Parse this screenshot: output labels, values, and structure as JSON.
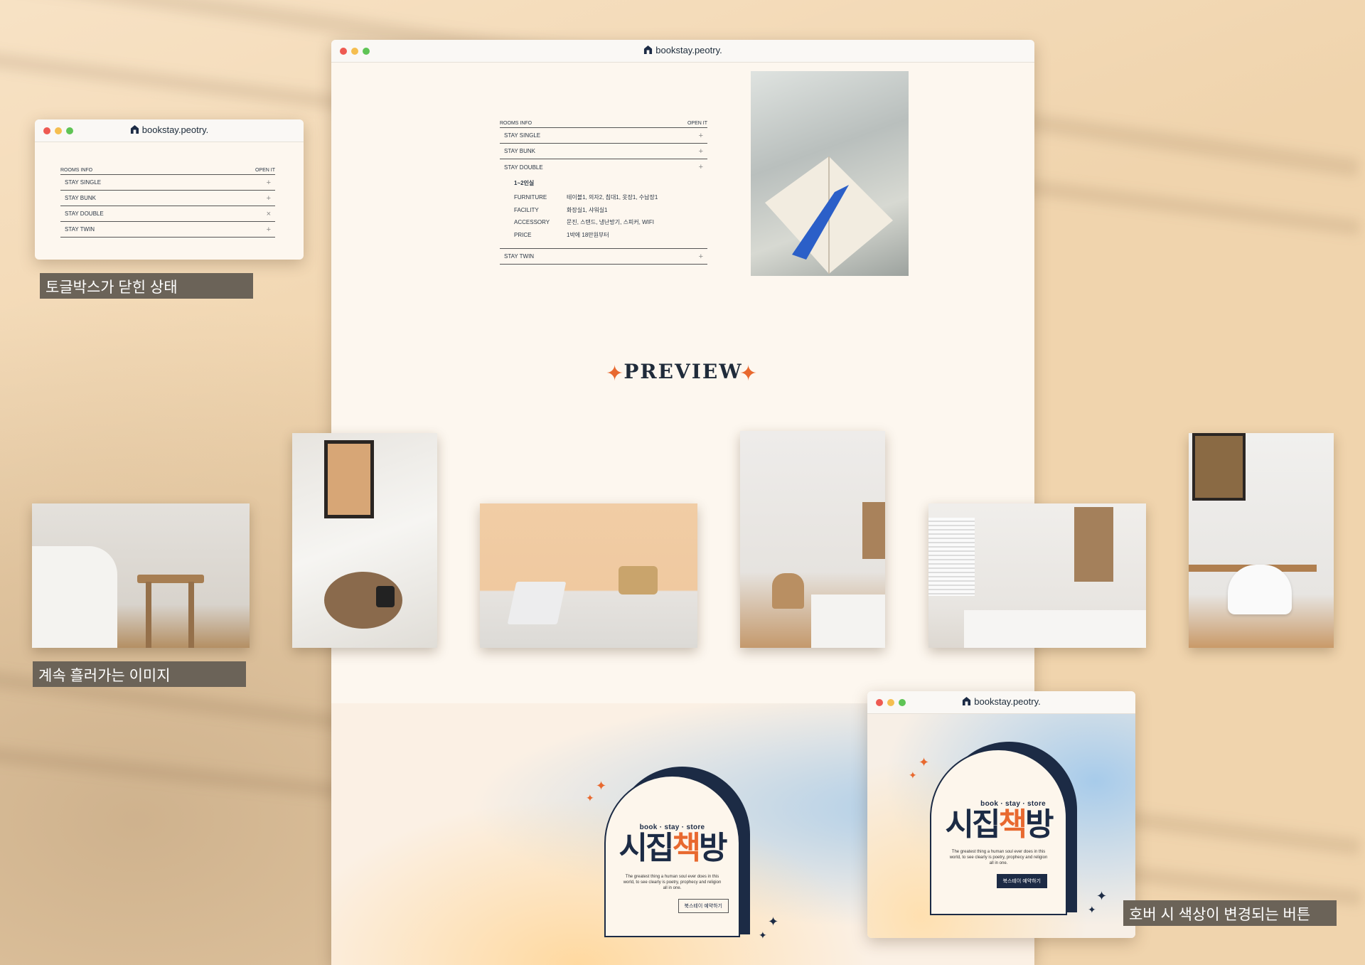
{
  "brand": "bookstay.peotry.",
  "small_window": {
    "title": "bookstay.peotry.",
    "header_left": "ROOMS INFO",
    "header_right": "OPEN IT",
    "rows": [
      {
        "label": "STAY SINGLE",
        "sign": "+"
      },
      {
        "label": "STAY BUNK",
        "sign": "+"
      },
      {
        "label": "STAY DOUBLE",
        "sign": "×"
      },
      {
        "label": "STAY TWIN",
        "sign": "+"
      }
    ]
  },
  "main_window": {
    "title": "bookstay.peotry.",
    "header_left": "ROOMS INFO",
    "header_right": "OPEN IT",
    "rows_top": [
      {
        "label": "STAY SINGLE",
        "sign": "+"
      },
      {
        "label": "STAY BUNK",
        "sign": "+"
      },
      {
        "label": "STAY DOUBLE",
        "sign": "+"
      }
    ],
    "detail": {
      "capacity": "1~2인실",
      "lines": [
        {
          "key": "FURNITURE",
          "value": "테이블1, 의자2, 침대1, 옷장1, 수납장1"
        },
        {
          "key": "FACILITY",
          "value": "화장실1, 샤워실1"
        },
        {
          "key": "ACCESSORY",
          "value": "문진, 스탠드, 냉난방기, 스피커, WIFI"
        },
        {
          "key": "PRICE",
          "value": "1박에 18만원부터"
        }
      ]
    },
    "row_bottom": {
      "label": "STAY TWIN",
      "sign": "+"
    },
    "preview_title": "PREVIEW"
  },
  "labels": {
    "toggle_closed": "토글박스가 닫힌 상태",
    "flowing_images": "계속 흘러가는 이미지",
    "hover_button": "호버 시 색상이 변경되는 버튼"
  },
  "card": {
    "small_title": "book · stay · store",
    "big_title_1": "시집",
    "big_title_2": "책",
    "big_title_3": "방",
    "tagline": "The greatest thing a human soul ever does in this world, to see clearly is poetry, prophecy and religion all in one.",
    "button": "북스테이 예약하기"
  },
  "hover_window": {
    "title": "bookstay.peotry."
  },
  "colors": {
    "accent": "#e8692f",
    "navy": "#1c2b45",
    "cream": "#fdf7ef"
  }
}
